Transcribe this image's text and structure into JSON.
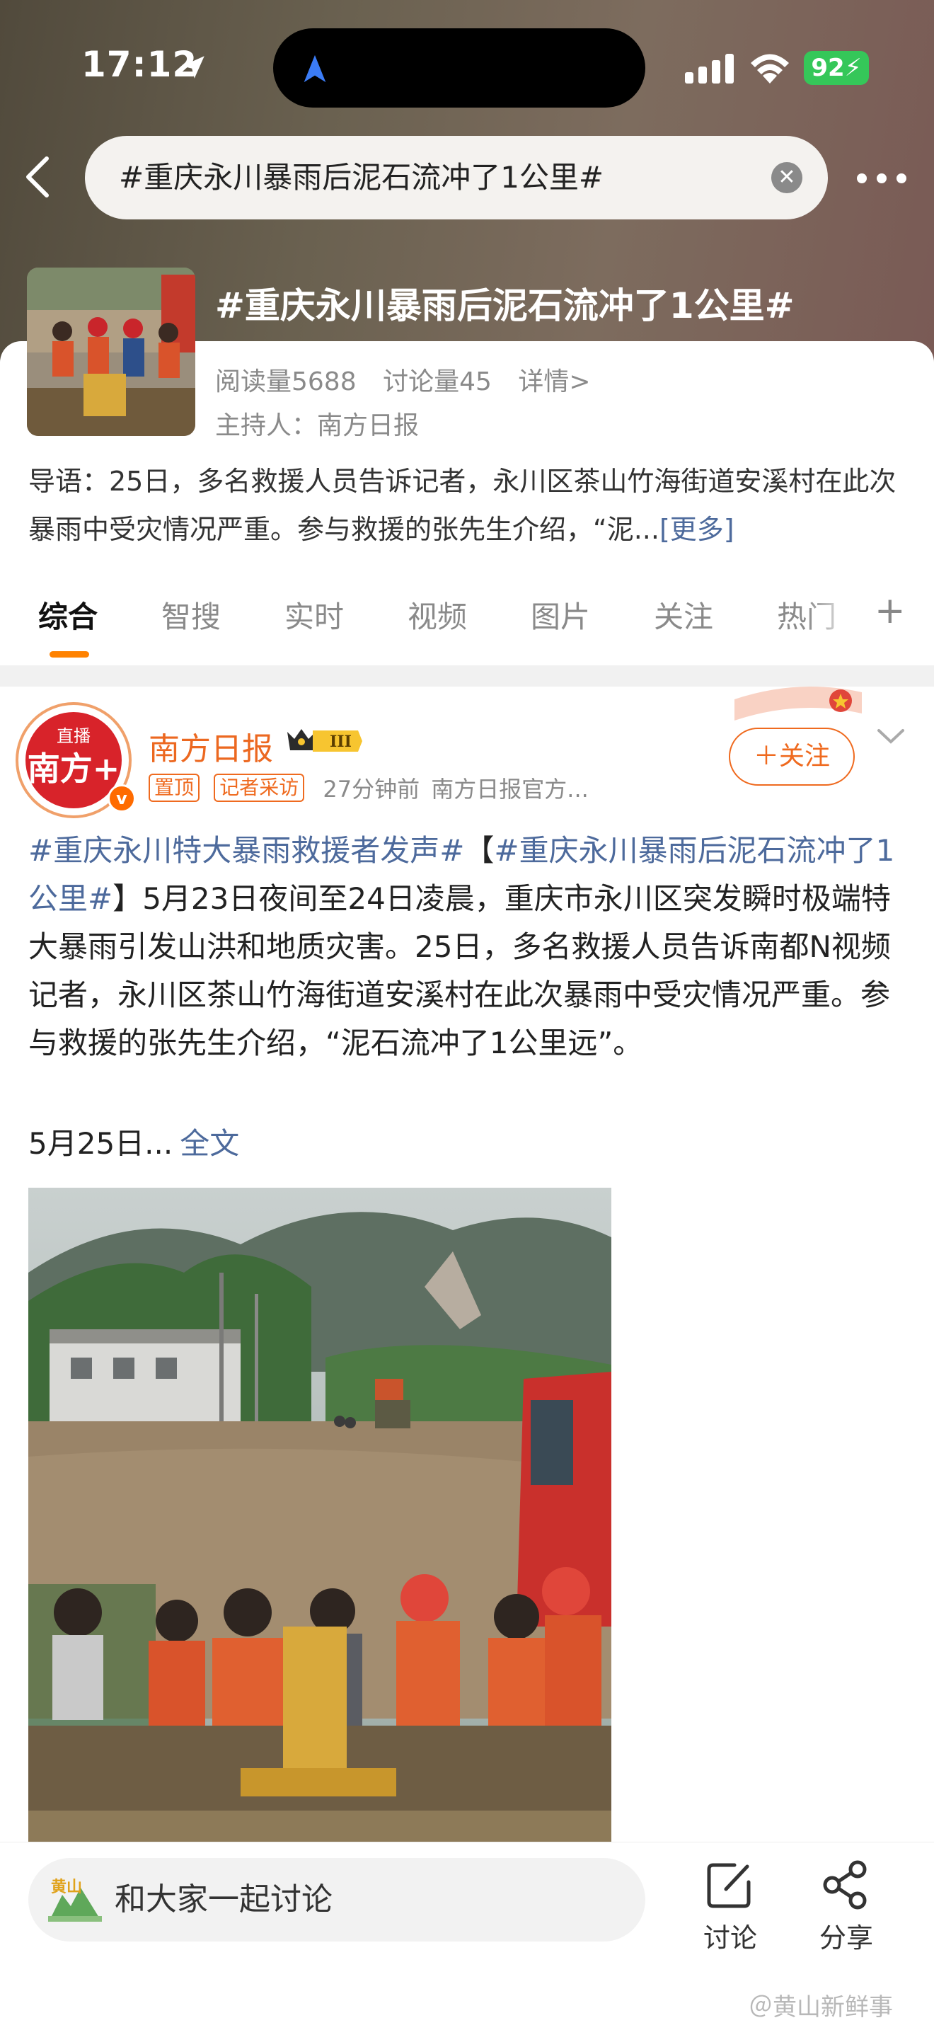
{
  "status_bar": {
    "time": "17:12",
    "battery": "92"
  },
  "search": {
    "query": "#重庆永川暴雨后泥石流冲了1公里#"
  },
  "topic": {
    "title": "#重庆永川暴雨后泥石流冲了1公里#",
    "reads": "阅读量5688",
    "discussions": "讨论量45",
    "details": "详情>",
    "host": "主持人：南方日报",
    "intro": "导语：25日，多名救援人员告诉记者，永川区茶山竹海街道安溪村在此次暴雨中受灾情况严重。参与救援的张先生介绍，“泥...",
    "intro_more": "[更多]"
  },
  "tabs": [
    "综合",
    "智搜",
    "实时",
    "视频",
    "图片",
    "关注",
    "热门"
  ],
  "post": {
    "author": "南方日报",
    "avatar_live": "直播",
    "avatar_text": "南方+",
    "vip_level": "III",
    "tag_pinned": "置顶",
    "tag_reporter": "记者采访",
    "time_ago": "27分钟前",
    "source": "南方日报官方...",
    "follow": "＋关注",
    "hashtag1": "#重庆永川特大暴雨救援者发声#",
    "bracket_open": "【",
    "hashtag2": "#重庆永川暴雨后泥石流冲了1公里#",
    "body": "】5月23日夜间至24日凌晨，重庆市永川区突发瞬时极端特大暴雨引发山洪和地质灾害。25日，多名救援人员告诉南都N视频记者，永川区茶山竹海街道安溪村在此次暴雨中受灾情况严重。参与救援的张先生介绍，“泥石流冲了1公里远”。",
    "date": "5月25日...",
    "full_text": "全文"
  },
  "bottom_bar": {
    "comment_placeholder": "和大家一起讨论",
    "comment_icon_text": "黄山",
    "discuss": "讨论",
    "share": "分享"
  },
  "watermark": "＠黄山新鲜事",
  "colors": {
    "accent": "#ef6a1f",
    "link": "#4d6a9c",
    "tab_indicator": "#ff8200"
  }
}
